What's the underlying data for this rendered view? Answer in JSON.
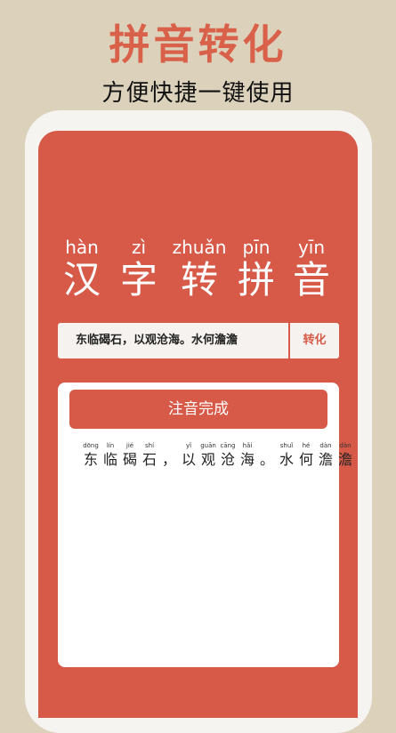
{
  "promo": {
    "title": "拼音转化",
    "subtitle": "方便快捷一键使用"
  },
  "hero": [
    {
      "pinyin": "hàn",
      "hanzi": "汉"
    },
    {
      "pinyin": "zì",
      "hanzi": "字"
    },
    {
      "pinyin": "zhuǎn",
      "hanzi": "转"
    },
    {
      "pinyin": "pīn",
      "hanzi": "拼"
    },
    {
      "pinyin": "yīn",
      "hanzi": "音"
    }
  ],
  "input": {
    "value": "东临碣石，以观沧海。水何澹澹"
  },
  "convert_button": "转化",
  "result": {
    "status": "注音完成",
    "chars": [
      {
        "pinyin": "dōng",
        "hanzi": "东"
      },
      {
        "pinyin": "lín",
        "hanzi": "临"
      },
      {
        "pinyin": "jié",
        "hanzi": "碣"
      },
      {
        "pinyin": "shí",
        "hanzi": "石"
      },
      {
        "pinyin": "",
        "hanzi": "，"
      },
      {
        "pinyin": "yǐ",
        "hanzi": "以"
      },
      {
        "pinyin": "guān",
        "hanzi": "观"
      },
      {
        "pinyin": "cāng",
        "hanzi": "沧"
      },
      {
        "pinyin": "hǎi",
        "hanzi": "海"
      },
      {
        "pinyin": "",
        "hanzi": "。"
      },
      {
        "pinyin": "shuǐ",
        "hanzi": "水"
      },
      {
        "pinyin": "hé",
        "hanzi": "何"
      },
      {
        "pinyin": "dàn",
        "hanzi": "澹"
      },
      {
        "pinyin": "dàn",
        "hanzi": "澹"
      }
    ]
  },
  "colors": {
    "accent": "#d65a47",
    "background": "#dcd1bb",
    "title": "#d9614a"
  }
}
